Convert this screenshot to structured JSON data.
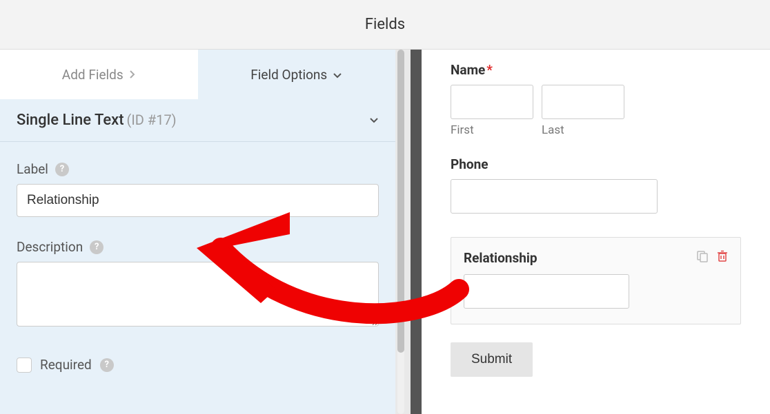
{
  "header": {
    "title": "Fields"
  },
  "tabs": {
    "add_fields": "Add Fields",
    "field_options": "Field Options"
  },
  "field_panel": {
    "type_label": "Single Line Text",
    "id_label": "(ID #17)",
    "label_text": "Label",
    "label_value": "Relationship",
    "description_text": "Description",
    "description_value": "",
    "required_text": "Required"
  },
  "preview": {
    "name_label": "Name",
    "first_label": "First",
    "last_label": "Last",
    "phone_label": "Phone",
    "relationship_label": "Relationship",
    "submit_label": "Submit"
  }
}
